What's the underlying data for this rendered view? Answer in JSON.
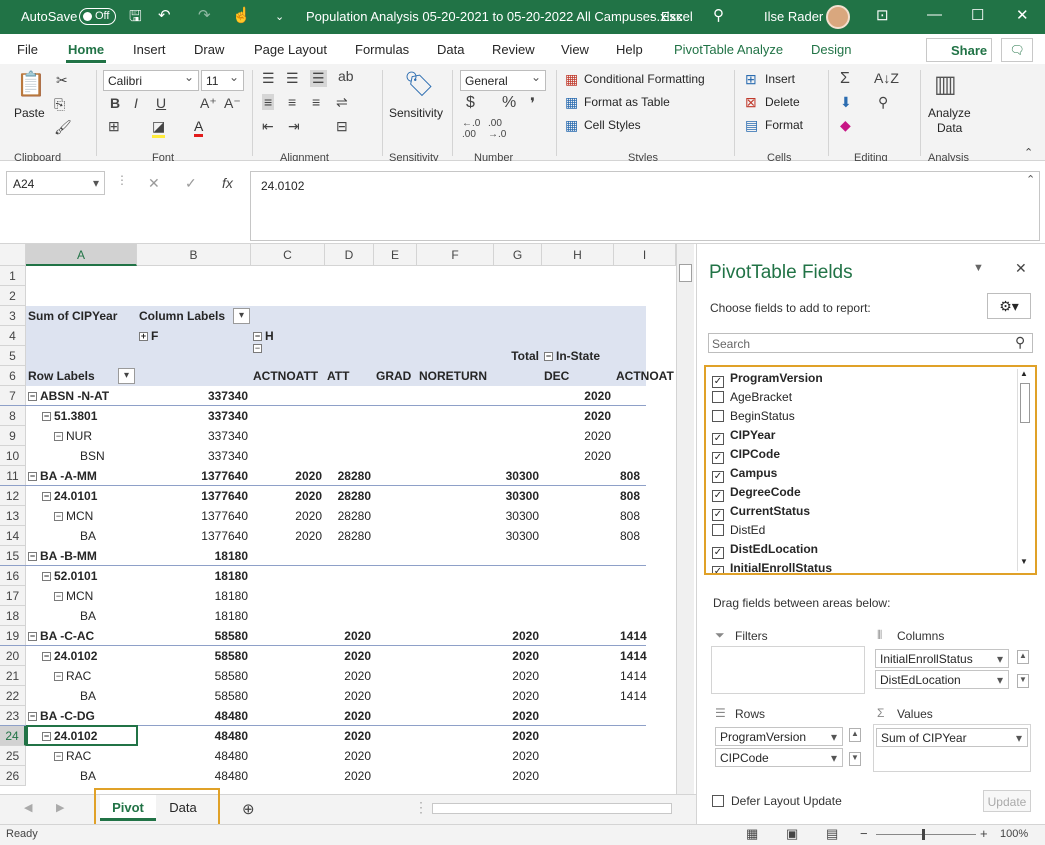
{
  "titlebar": {
    "autosave": "AutoSave",
    "toggle": "Off",
    "filename": "Population Analysis 05-20-2021 to 05-20-2022 All Campuses.xlsx",
    "app": "Excel",
    "user": "Ilse Rader"
  },
  "tabs": [
    "File",
    "Home",
    "Insert",
    "Draw",
    "Page Layout",
    "Formulas",
    "Data",
    "Review",
    "View",
    "Help",
    "PivotTable Analyze",
    "Design"
  ],
  "share": "Share",
  "ribbon": {
    "paste": "Paste",
    "font_name": "Calibri",
    "font_size": "11",
    "number_format": "General",
    "conditional": "Conditional Formatting",
    "format_table": "Format as Table",
    "cell_styles": "Cell Styles",
    "insert": "Insert",
    "delete": "Delete",
    "format": "Format",
    "sensitivity": "Sensitivity",
    "analyze1": "Analyze",
    "analyze2": "Data",
    "groups": [
      "Clipboard",
      "Font",
      "Alignment",
      "Sensitivity",
      "Number",
      "Styles",
      "Cells",
      "Editing",
      "Analysis"
    ]
  },
  "formula": {
    "namebox": "A24",
    "value": "24.0102"
  },
  "columns": [
    "A",
    "B",
    "C",
    "D",
    "E",
    "F",
    "G",
    "H",
    "I"
  ],
  "rows": [
    "1",
    "2",
    "3",
    "4",
    "5",
    "6",
    "7",
    "8",
    "9",
    "10",
    "11",
    "12",
    "13",
    "14",
    "15",
    "16",
    "17",
    "18",
    "19",
    "20",
    "21",
    "22",
    "23",
    "24",
    "25",
    "26"
  ],
  "pivot": {
    "sum_label": "Sum of CIPYear",
    "column_labels": "Column Labels",
    "f": "F",
    "h": "H",
    "total": "Total",
    "instate": "In-State",
    "row_labels": "Row Labels",
    "hdr6": [
      "ACTNOATT",
      "ATT",
      "GRAD",
      "NORETURN",
      "DEC",
      "ACTNOAT"
    ],
    "data": [
      [
        "ABSN -N-AT",
        "337340",
        "",
        "",
        "",
        "",
        "",
        "2020",
        ""
      ],
      [
        "51.3801",
        "337340",
        "",
        "",
        "",
        "",
        "",
        "2020",
        ""
      ],
      [
        "NUR",
        "337340",
        "",
        "",
        "",
        "",
        "",
        "2020",
        ""
      ],
      [
        "BSN",
        "337340",
        "",
        "",
        "",
        "",
        "",
        "2020",
        ""
      ],
      [
        "BA -A-MM",
        "1377640",
        "2020",
        "28280",
        "",
        "",
        "30300",
        "",
        "808"
      ],
      [
        "24.0101",
        "1377640",
        "2020",
        "28280",
        "",
        "",
        "30300",
        "",
        "808"
      ],
      [
        "MCN",
        "1377640",
        "2020",
        "28280",
        "",
        "",
        "30300",
        "",
        "808"
      ],
      [
        "BA",
        "1377640",
        "2020",
        "28280",
        "",
        "",
        "30300",
        "",
        "808"
      ],
      [
        "BA -B-MM",
        "18180",
        "",
        "",
        "",
        "",
        "",
        "",
        ""
      ],
      [
        "52.0101",
        "18180",
        "",
        "",
        "",
        "",
        "",
        "",
        ""
      ],
      [
        "MCN",
        "18180",
        "",
        "",
        "",
        "",
        "",
        "",
        ""
      ],
      [
        "BA",
        "18180",
        "",
        "",
        "",
        "",
        "",
        "",
        ""
      ],
      [
        "BA -C-AC",
        "58580",
        "",
        "2020",
        "",
        "",
        "2020",
        "",
        "1414"
      ],
      [
        "24.0102",
        "58580",
        "",
        "2020",
        "",
        "",
        "2020",
        "",
        "1414"
      ],
      [
        "RAC",
        "58580",
        "",
        "2020",
        "",
        "",
        "2020",
        "",
        "1414"
      ],
      [
        "BA",
        "58580",
        "",
        "2020",
        "",
        "",
        "2020",
        "",
        "1414"
      ],
      [
        "BA -C-DG",
        "48480",
        "",
        "2020",
        "",
        "",
        "2020",
        "",
        ""
      ],
      [
        "24.0102",
        "48480",
        "",
        "2020",
        "",
        "",
        "2020",
        "",
        ""
      ],
      [
        "RAC",
        "48480",
        "",
        "2020",
        "",
        "",
        "2020",
        "",
        ""
      ],
      [
        "BA",
        "48480",
        "",
        "2020",
        "",
        "",
        "2020",
        "",
        ""
      ]
    ]
  },
  "sheets": [
    "Pivot",
    "Data"
  ],
  "status": {
    "ready": "Ready",
    "zoom": "100%"
  },
  "pane": {
    "title": "PivotTable Fields",
    "sub": "Choose fields to add to report:",
    "search": "Search",
    "fields": [
      {
        "name": "ProgramVersion",
        "checked": true
      },
      {
        "name": "AgeBracket",
        "checked": false
      },
      {
        "name": "BeginStatus",
        "checked": false
      },
      {
        "name": "CIPYear",
        "checked": true
      },
      {
        "name": "CIPCode",
        "checked": true
      },
      {
        "name": "Campus",
        "checked": true
      },
      {
        "name": "DegreeCode",
        "checked": true
      },
      {
        "name": "CurrentStatus",
        "checked": true
      },
      {
        "name": "DistEd",
        "checked": false
      },
      {
        "name": "DistEdLocation",
        "checked": true
      },
      {
        "name": "InitialEnrollStatus",
        "checked": true
      }
    ],
    "drag": "Drag fields between areas below:",
    "filters": "Filters",
    "columns": "Columns",
    "rows": "Rows",
    "values": "Values",
    "col_items": [
      "InitialEnrollStatus",
      "DistEdLocation"
    ],
    "row_items": [
      "ProgramVersion",
      "CIPCode"
    ],
    "val_items": [
      "Sum of CIPYear"
    ],
    "defer": "Defer Layout Update",
    "update": "Update"
  }
}
